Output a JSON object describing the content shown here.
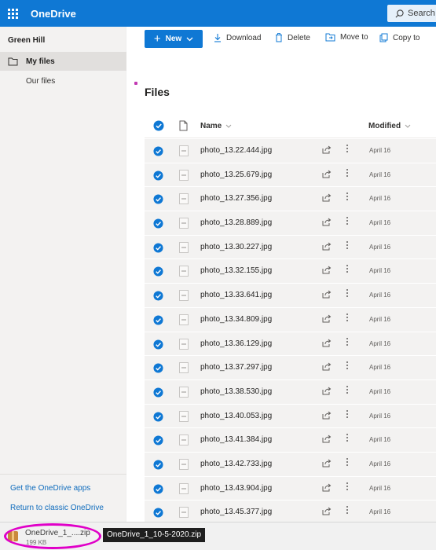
{
  "app": {
    "title": "OneDrive",
    "search_placeholder": "Search"
  },
  "sidebar": {
    "tenant": "Green Hill",
    "items": [
      {
        "label": "My files",
        "selected": true
      },
      {
        "label": "Our files",
        "selected": false
      }
    ],
    "footer_links": [
      "Get the OneDrive apps",
      "Return to classic OneDrive"
    ]
  },
  "toolbar": {
    "new_label": "New",
    "download_label": "Download",
    "delete_label": "Delete",
    "move_label": "Move to",
    "copy_label": "Copy to"
  },
  "main": {
    "title": "Files",
    "columns": {
      "name": "Name",
      "modified": "Modified"
    },
    "files": [
      {
        "name": "photo_13.22.444.jpg",
        "modified": "April 16",
        "selected": true
      },
      {
        "name": "photo_13.25.679.jpg",
        "modified": "April 16",
        "selected": true
      },
      {
        "name": "photo_13.27.356.jpg",
        "modified": "April 16",
        "selected": true
      },
      {
        "name": "photo_13.28.889.jpg",
        "modified": "April 16",
        "selected": true
      },
      {
        "name": "photo_13.30.227.jpg",
        "modified": "April 16",
        "selected": true
      },
      {
        "name": "photo_13.32.155.jpg",
        "modified": "April 16",
        "selected": true
      },
      {
        "name": "photo_13.33.641.jpg",
        "modified": "April 16",
        "selected": true
      },
      {
        "name": "photo_13.34.809.jpg",
        "modified": "April 16",
        "selected": true
      },
      {
        "name": "photo_13.36.129.jpg",
        "modified": "April 16",
        "selected": true
      },
      {
        "name": "photo_13.37.297.jpg",
        "modified": "April 16",
        "selected": true
      },
      {
        "name": "photo_13.38.530.jpg",
        "modified": "April 16",
        "selected": true
      },
      {
        "name": "photo_13.40.053.jpg",
        "modified": "April 16",
        "selected": true
      },
      {
        "name": "photo_13.41.384.jpg",
        "modified": "April 16",
        "selected": true
      },
      {
        "name": "photo_13.42.733.jpg",
        "modified": "April 16",
        "selected": true
      },
      {
        "name": "photo_13.43.904.jpg",
        "modified": "April 16",
        "selected": true
      },
      {
        "name": "photo_13.45.377.jpg",
        "modified": "April 16",
        "selected": true
      }
    ]
  },
  "download_bar": {
    "file_short": "OneDrive_1_....zip",
    "file_size": "199 KB",
    "tooltip": "OneDrive_1_10-5-2020.zip"
  },
  "colors": {
    "brand_blue": "#0f78d4",
    "highlight_ring": "#e000c8",
    "row_selected_bg": "#f3f2f1"
  },
  "icons": {
    "app_launcher": "waffle-icon",
    "search": "search-icon",
    "folder": "folder-icon",
    "download": "download-icon",
    "delete": "trash-icon",
    "move": "move-icon",
    "copy": "copy-icon",
    "check": "check-circle-icon",
    "file_type": "document-icon",
    "share": "share-icon",
    "more": "more-vertical-icon",
    "zip": "zip-file-icon"
  }
}
